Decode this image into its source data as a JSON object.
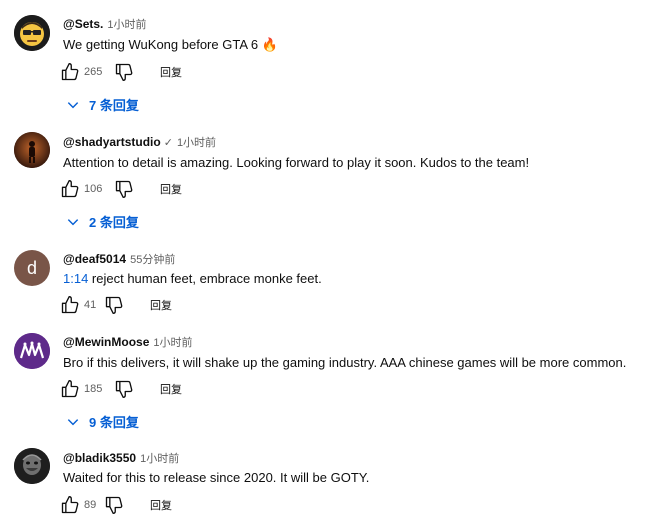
{
  "comments": [
    {
      "author": "@Sets.",
      "time": "1小时前",
      "text": "We getting WuKong before GTA 6 🔥",
      "likes": "265",
      "reply_label": "回复",
      "replies_label": "7 条回复"
    },
    {
      "author": "@shadyartstudio",
      "verified": "✓",
      "time": "1小时前",
      "text": "Attention to detail is amazing. Looking forward to play it soon. Kudos to the team!",
      "likes": "106",
      "reply_label": "回复",
      "replies_label": "2 条回复"
    },
    {
      "author": "@deaf5014",
      "time": "55分钟前",
      "avatar_letter": "d",
      "timestamp_link": "1:14",
      "text": " reject human feet, embrace monke feet.",
      "likes": "41",
      "reply_label": "回复"
    },
    {
      "author": "@MewinMoose",
      "time": "1小时前",
      "text": "Bro if this delivers, it will shake up the gaming industry. AAA chinese games will be more common.",
      "likes": "185",
      "reply_label": "回复",
      "replies_label": "9 条回复"
    },
    {
      "author": "@bladik3550",
      "time": "1小时前",
      "text": "Waited for this to release since 2020. It will be GOTY.",
      "likes": "89",
      "reply_label": "回复"
    }
  ],
  "colors": {
    "link_blue": "#065fd4",
    "secondary_text": "#606060",
    "avatar_deaf": "#795548",
    "avatar_mewin": "#5e2a8a"
  },
  "icons": [
    "like-icon",
    "dislike-icon",
    "chevron-down-icon",
    "verified-check-icon"
  ]
}
